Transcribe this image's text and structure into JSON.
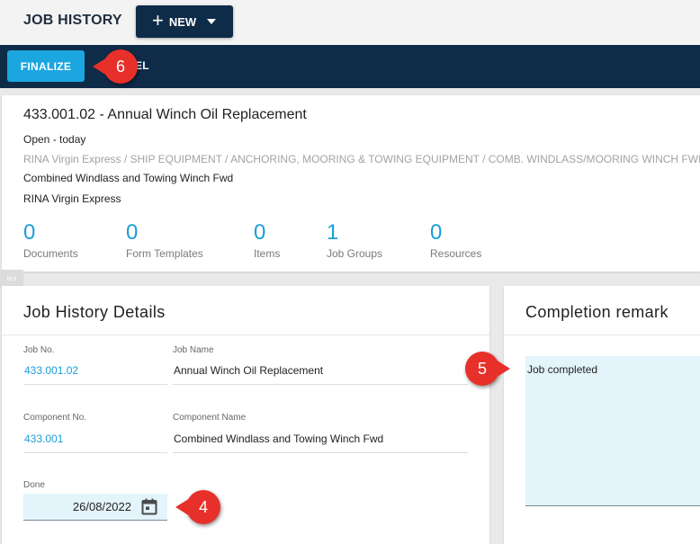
{
  "header": {
    "title": "JOB HISTORY",
    "new_button_label": "NEW",
    "new_button_icon": "plus-icon"
  },
  "actions": {
    "finalize_label": "FINALIZE",
    "cancel_label": "EL"
  },
  "job": {
    "title": "433.001.02 - Annual Winch Oil Replacement",
    "status": "Open - today",
    "path": "RINA Virgin Express / SHIP EQUIPMENT / ANCHORING, MOORING & TOWING EQUIPMENT / COMB. WINDLASS/MOORING WINCH FWD",
    "component": "Combined Windlass and Towing Winch Fwd",
    "vessel": "RINA Virgin Express",
    "stats": [
      {
        "value": "0",
        "label": "Documents"
      },
      {
        "value": "0",
        "label": "Form Templates"
      },
      {
        "value": "0",
        "label": "Items"
      },
      {
        "value": "1",
        "label": "Job Groups"
      },
      {
        "value": "0",
        "label": "Resources"
      }
    ]
  },
  "tag": "tics",
  "details": {
    "heading": "Job History Details",
    "job_no_label": "Job No.",
    "job_no": "433.001.02",
    "job_name_label": "Job Name",
    "job_name": "Annual Winch Oil Replacement",
    "component_no_label": "Component No.",
    "component_no": "433.001",
    "component_name_label": "Component Name",
    "component_name": "Combined Windlass and Towing Winch Fwd",
    "done_label": "Done",
    "done_date": "26/08/2022",
    "calendar_icon": "calendar-icon"
  },
  "remark": {
    "heading": "Completion remark",
    "text": "Job completed"
  },
  "callouts": [
    "6",
    "5",
    "4"
  ],
  "colors": {
    "navy": "#0e2b47",
    "accent_blue": "#1ba6e0",
    "link_blue": "#1a9fd6",
    "callout_red": "#e8302a",
    "input_bg": "#e3f4fb"
  }
}
